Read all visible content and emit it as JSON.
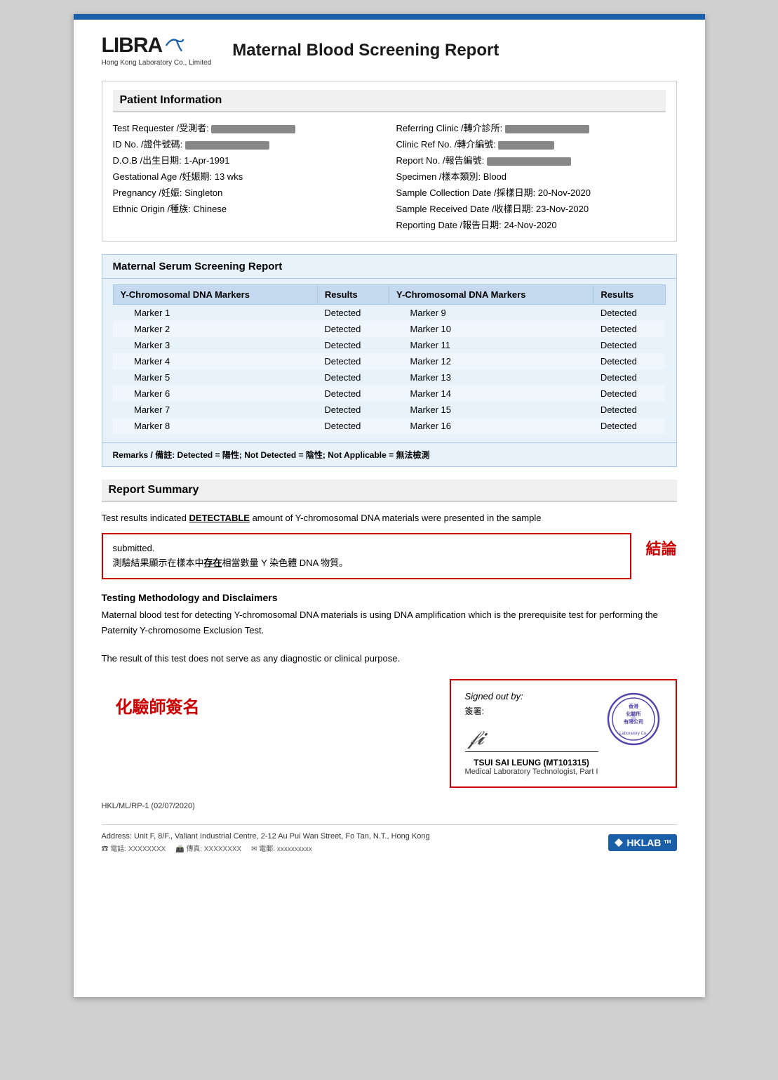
{
  "page": {
    "top_bar_color": "#1a5fa8"
  },
  "header": {
    "logo_text": "LIBRA",
    "logo_subtitle": "Hong Kong Laboratory Co., Limited",
    "report_title": "Maternal Blood Screening Report"
  },
  "patient_section": {
    "label": "Patient Information",
    "left_fields": [
      {
        "label": "Test Requester /受測者:",
        "value": "REDACTED"
      },
      {
        "label": "ID No. /證件號碼:",
        "value": "REDACTED"
      },
      {
        "label": "D.O.B /出生日期:",
        "value": "1-Apr-1991"
      },
      {
        "label": "Gestational Age /妊娠期:",
        "value": "13 wks"
      },
      {
        "label": "Pregnancy /妊娠:",
        "value": "Singleton"
      },
      {
        "label": "Ethnic Origin /種族:",
        "value": "Chinese"
      }
    ],
    "right_fields": [
      {
        "label": "Referring Clinic /轉介診所:",
        "value": "REDACTED"
      },
      {
        "label": "Clinic Ref No. /轉介編號:",
        "value": "REDACTED"
      },
      {
        "label": "Report No. /報告編號:",
        "value": "REDACTED"
      },
      {
        "label": "Specimen /樣本類別:",
        "value": "Blood"
      },
      {
        "label": "Sample Collection Date /採樣日期:",
        "value": "20-Nov-2020"
      },
      {
        "label": "Sample Received Date /收樣日期:",
        "value": "23-Nov-2020"
      },
      {
        "label": "Reporting Date /報告日期:",
        "value": "24-Nov-2020"
      }
    ]
  },
  "screening_section": {
    "label": "Maternal Serum Screening Report",
    "col1_header": "Y-Chromosomal DNA Markers",
    "col2_header": "Results",
    "col3_header": "Y-Chromosomal DNA Markers",
    "col4_header": "Results",
    "left_markers": [
      {
        "name": "Marker 1",
        "result": "Detected"
      },
      {
        "name": "Marker 2",
        "result": "Detected"
      },
      {
        "name": "Marker 3",
        "result": "Detected"
      },
      {
        "name": "Marker 4",
        "result": "Detected"
      },
      {
        "name": "Marker 5",
        "result": "Detected"
      },
      {
        "name": "Marker 6",
        "result": "Detected"
      },
      {
        "name": "Marker 7",
        "result": "Detected"
      },
      {
        "name": "Marker 8",
        "result": "Detected"
      }
    ],
    "right_markers": [
      {
        "name": "Marker 9",
        "result": "Detected"
      },
      {
        "name": "Marker 10",
        "result": "Detected"
      },
      {
        "name": "Marker 11",
        "result": "Detected"
      },
      {
        "name": "Marker 12",
        "result": "Detected"
      },
      {
        "name": "Marker 13",
        "result": "Detected"
      },
      {
        "name": "Marker 14",
        "result": "Detected"
      },
      {
        "name": "Marker 15",
        "result": "Detected"
      },
      {
        "name": "Marker 16",
        "result": "Detected"
      }
    ],
    "remarks": "Remarks / 備註: Detected = 陽性; Not Detected = 陰性; Not Applicable = 無法檢測"
  },
  "report_summary": {
    "label": "Report Summary",
    "text_line1": "Test results indicated ",
    "detectable_word": "DETECTABLE",
    "text_line2": " amount of Y-chromosomal DNA materials were presented in the sample",
    "submitted_text": "submitted.",
    "chinese_line": "測驗結果顯示在樣本中",
    "chinese_underline": "存在",
    "chinese_line2": "相當數量 Y 染色體 DNA 物質。",
    "conclusion_label": "結論"
  },
  "methodology": {
    "title": "Testing Methodology and Disclaimers",
    "text1": "Maternal blood test for detecting Y-chromosomal DNA materials is using DNA amplification which is the prerequisite test for performing the Paternity Y-chromosome Exclusion Test.",
    "text2": "The result of this test does not serve as any diagnostic or clinical purpose."
  },
  "signature": {
    "chinese_label": "化驗師簽名",
    "signed_out_by": "Signed out by:",
    "signed_out_chinese": "簽署:",
    "signer_name": "TSUI SAI LEUNG (MT101315)",
    "signer_title": "Medical Laboratory Technologist, Part I"
  },
  "footer": {
    "doc_number": "HKL/ML/RP-1 (02/07/2020)",
    "address": "Address: Unit F, 8/F., Valiant Industrial Centre, 2-12 Au Pui Wan Street, Fo Tan, N.T., Hong Kong",
    "phone_info": "電話: XXXXXXXX    傳真: XXXXXXXX    電郵: xxxxxxxxxx",
    "hklab_text": "HKLAB"
  }
}
